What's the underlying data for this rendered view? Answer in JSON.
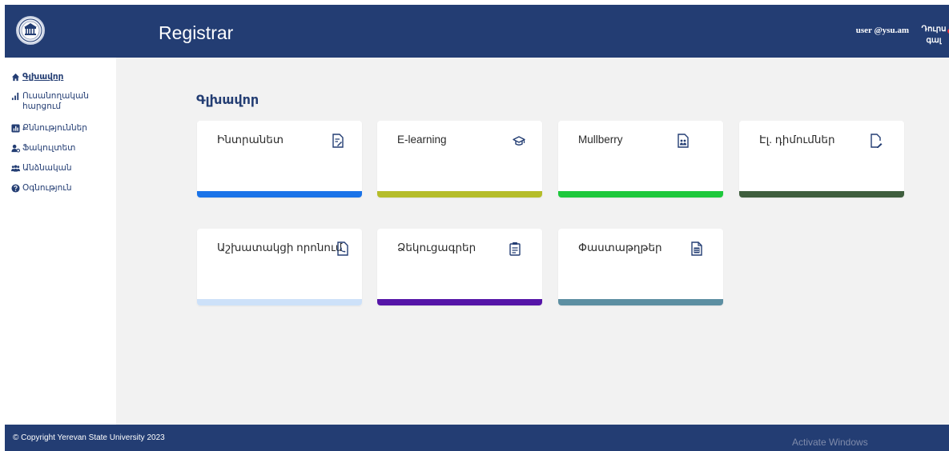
{
  "header": {
    "app_title": "Registrar",
    "user_email": "user @ysu.am",
    "logout_label": "Դուրս գալ"
  },
  "sidebar": {
    "items": [
      {
        "label": "Գլխավոր",
        "icon": "home-icon",
        "active": true
      },
      {
        "label": "Ուսանողական հարցում",
        "icon": "bar-chart-icon",
        "active": false
      },
      {
        "label": "Քննություններ",
        "icon": "chart-box-icon",
        "active": false
      },
      {
        "label": "Ֆակուլտետ",
        "icon": "users-cog-icon",
        "active": false
      },
      {
        "label": "Անձնական",
        "icon": "people-icon",
        "active": false
      },
      {
        "label": "Օգնություն",
        "icon": "help-circle-icon",
        "active": false
      }
    ]
  },
  "main": {
    "page_title": "Գլխավոր",
    "cards": [
      {
        "label": "Ինտրանետ",
        "icon": "document-edit-icon",
        "bar_color": "#1a73e8"
      },
      {
        "label": "E-learning",
        "icon": "graduation-cap-icon",
        "bar_color": "#b5bd2a"
      },
      {
        "label": "Mullberry",
        "icon": "document-people-icon",
        "bar_color": "#1ec83c"
      },
      {
        "label": "Էլ. դիմումներ",
        "icon": "file-pen-icon",
        "bar_color": "#3f5e3e"
      },
      {
        "label": "Աշխատակցի որոնում",
        "icon": "document-phone-icon",
        "bar_color": "#cde1f9"
      },
      {
        "label": "Ձեկուցագրեր",
        "icon": "clipboard-icon",
        "bar_color": "#5615a8"
      },
      {
        "label": "Փաստաթղթեր",
        "icon": "file-lines-icon",
        "bar_color": "#5d8fa2"
      }
    ]
  },
  "footer": {
    "copyright": "© Copyright Yerevan State University 2023",
    "watermark": "Activate Windows"
  },
  "colors": {
    "header_bg": "#233d73",
    "main_bg": "#f2f2f2",
    "nav_text": "#233d73"
  }
}
